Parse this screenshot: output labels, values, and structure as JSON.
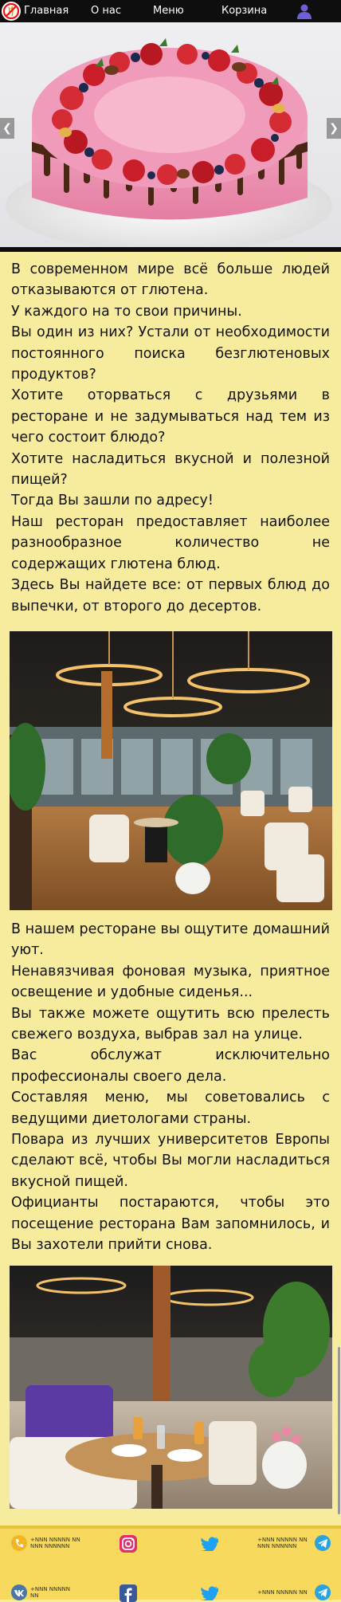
{
  "nav": {
    "items": [
      "Главная",
      "О нас",
      "Меню",
      "Корзина"
    ],
    "logo_icon": "no-gluten-icon",
    "user_icon": "user-icon"
  },
  "hero": {
    "image": "strawberry-cake-photo",
    "prev_icon": "chevron-left-icon",
    "next_icon": "chevron-right-icon"
  },
  "intro": [
    "В современном мире всё больше людей отказываются от глютена.",
    "У каждого на то свои причины.",
    "Вы один из них? Устали от необходимости постоянного поиска безглютеновых продуктов?",
    "Хотите оторваться с друзьями в ресторане и не задумываться над тем из чего состоит блюдо?",
    "Хотите насладиться вкусной и полезной пищей?",
    "Тогда Вы зашли по адресу!",
    "Наш ресторан предоставляет наиболее разнообразное количество не содержащих глютена блюд.",
    "Здесь Вы найдете все: от первых блюд до выпечки, от второго до десертов."
  ],
  "about": [
    "В нашем ресторане вы ощутите домашний уют.",
    "Ненавязчивая фоновая музыка, приятное освещение и удобные сиденья...",
    "Вы также можете ощутить всю прелесть свежего воздуха, выбрав зал на улице.",
    "Вас обслужат исключительно профессионалы своего дела.",
    "Составляя меню, мы советовались с ведущими диетологами страны.",
    "Повара из лучших университетов Европы сделают всё, чтобы Вы могли насладиться вкусной пищей.",
    "Официанты постараются, чтобы это посещение ресторана Вам запомнилось, и Вы захотели прийти снова."
  ],
  "photos": [
    "restaurant-hall-photo",
    "restaurant-table-photo"
  ],
  "footer": {
    "phone_1": "+NNN NNNNN NN NNN NNNNNN",
    "phone_2": "+NNN NNNNN NN NNN NNNNNN",
    "phone_3": "+NNN NNNNN NN",
    "phone_4": "+NNN NNNNN NN",
    "icons": [
      "phone-icon",
      "instagram-icon",
      "twitter-icon",
      "telegram-icon",
      "vk-icon",
      "facebook-icon",
      "twitter-icon",
      "telegram-icon"
    ]
  }
}
